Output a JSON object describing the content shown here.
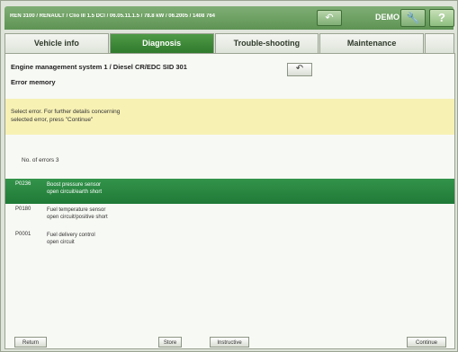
{
  "header": {
    "vehicle_path": "REN 3100 / RENAULT / Clio III 1.5 DCI / 06.05.11.1.5 / 78.8 kW / 06.2005 / 1408 764",
    "back_icon": "back-arrow-icon",
    "demo_label": "DEMO",
    "wrench_icon": "wrench-icon",
    "help_label": "?"
  },
  "tabs": [
    {
      "label": "Vehicle info",
      "active": false
    },
    {
      "label": "Diagnosis",
      "active": true
    },
    {
      "label": "Trouble-shooting",
      "active": false
    },
    {
      "label": "Maintenance",
      "active": false
    }
  ],
  "main": {
    "system_title": "Engine management system 1 / Diesel CR/EDC SID 301",
    "subtitle": "Error memory",
    "note_line1": "Select error. For further details concerning",
    "note_line2": "selected error, press \"Continue\"",
    "error_count": "No. of errors 3"
  },
  "errors": [
    {
      "code": "P0236",
      "desc1": "Boost pressure sensor",
      "desc2": "open circuit/earth short",
      "selected": true
    },
    {
      "code": "P0180",
      "desc1": "Fuel temperature sensor",
      "desc2": "open circuit/positive short",
      "selected": false
    },
    {
      "code": "P0001",
      "desc1": "Fuel delivery control",
      "desc2": "open circuit",
      "selected": false
    }
  ],
  "footer": {
    "return_label": "Return",
    "store_label": "Store",
    "instructive_label": "Instructive",
    "continue_label": "Continue"
  },
  "colors": {
    "accent": "#2f7a2c",
    "selected_row": "#1f7a37",
    "note_bg": "#f7f1b4"
  }
}
